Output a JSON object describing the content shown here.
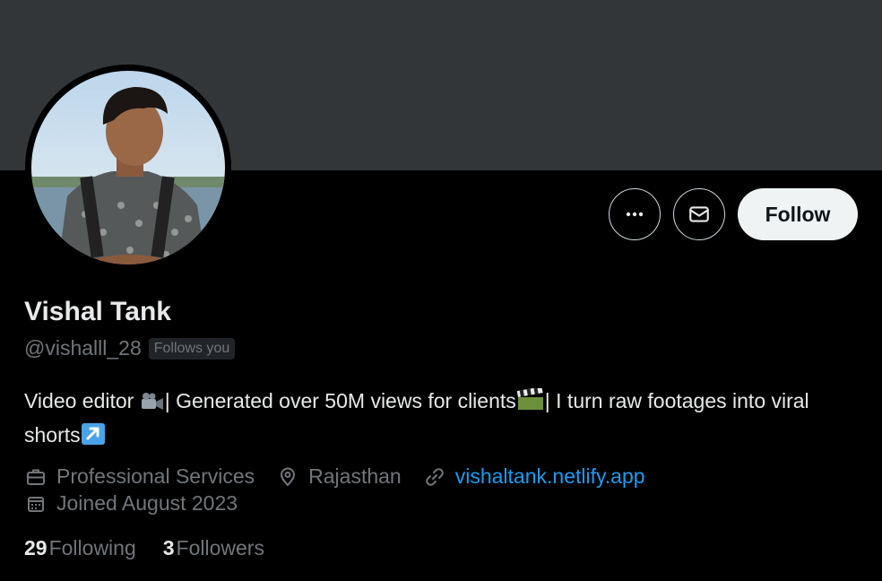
{
  "profile": {
    "name": "Vishal Tank",
    "handle": "@vishalll_28",
    "follows_you_badge": "Follows you",
    "bio_part1": "Video editor ",
    "bio_part2": "| Generated over 50M views for clients",
    "bio_part3": "| I turn raw footages into viral shorts",
    "category": "Professional Services",
    "location": "Rajasthan",
    "website": "vishaltank.netlify.app",
    "joined": "Joined August 2023",
    "following_count": "29",
    "following_label": "Following",
    "followers_count": "3",
    "followers_label": "Followers"
  },
  "actions": {
    "follow_label": "Follow"
  },
  "icons": {
    "more": "more-horizontal-icon",
    "message": "envelope-icon",
    "category": "briefcase-icon",
    "location": "location-pin-icon",
    "website": "link-icon",
    "joined": "calendar-icon"
  },
  "colors": {
    "banner": "#333639",
    "background": "#000000",
    "text_primary": "#e7e9ea",
    "text_secondary": "#71767b",
    "link": "#1d9bf0",
    "follow_bg": "#eff3f4"
  }
}
